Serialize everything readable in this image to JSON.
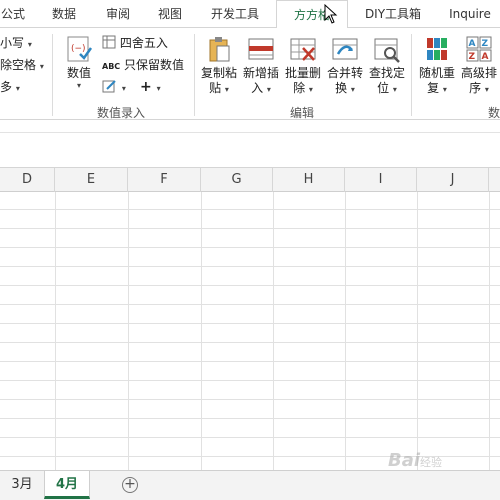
{
  "tabs": [
    {
      "label": "公式",
      "active": false
    },
    {
      "label": "数据",
      "active": false
    },
    {
      "label": "审阅",
      "active": false
    },
    {
      "label": "视图",
      "active": false
    },
    {
      "label": "开发工具",
      "active": false
    },
    {
      "label": "方方格",
      "active": true
    },
    {
      "label": "DIY工具箱",
      "active": false
    },
    {
      "label": "Inquire",
      "active": false
    }
  ],
  "ribbon": {
    "left_partial": {
      "items": [
        "小写",
        "除空格",
        "多"
      ]
    },
    "data_entry_group": {
      "label": "数值录入",
      "value_button": "数值",
      "round_label": "四舍五入",
      "keep_value_label": "只保留数值",
      "abc_glyph": "ABC",
      "plus_glyph": "+"
    },
    "edit_group": {
      "label": "编辑",
      "buttons": [
        {
          "label1": "复制粘",
          "label2": "贴"
        },
        {
          "label1": "新增插",
          "label2": "入"
        },
        {
          "label1": "批量删",
          "label2": "除"
        },
        {
          "label1": "合并转",
          "label2": "换"
        },
        {
          "label1": "查找定",
          "label2": "位"
        }
      ]
    },
    "right_partial": {
      "buttons": [
        {
          "label1": "随机重",
          "label2": "复"
        },
        {
          "label1": "高级排",
          "label2": "序"
        }
      ],
      "group_label_partial": "数"
    }
  },
  "columns": [
    "D",
    "E",
    "F",
    "G",
    "H",
    "I",
    "J"
  ],
  "sheets": [
    {
      "label": "3月",
      "active": false
    },
    {
      "label": "4月",
      "active": true
    }
  ],
  "add_sheet_glyph": "+",
  "watermark": {
    "text": "Bai",
    "suffix": "经验"
  },
  "colors": {
    "accent": "#217346",
    "grid": "#e1e1e1"
  }
}
